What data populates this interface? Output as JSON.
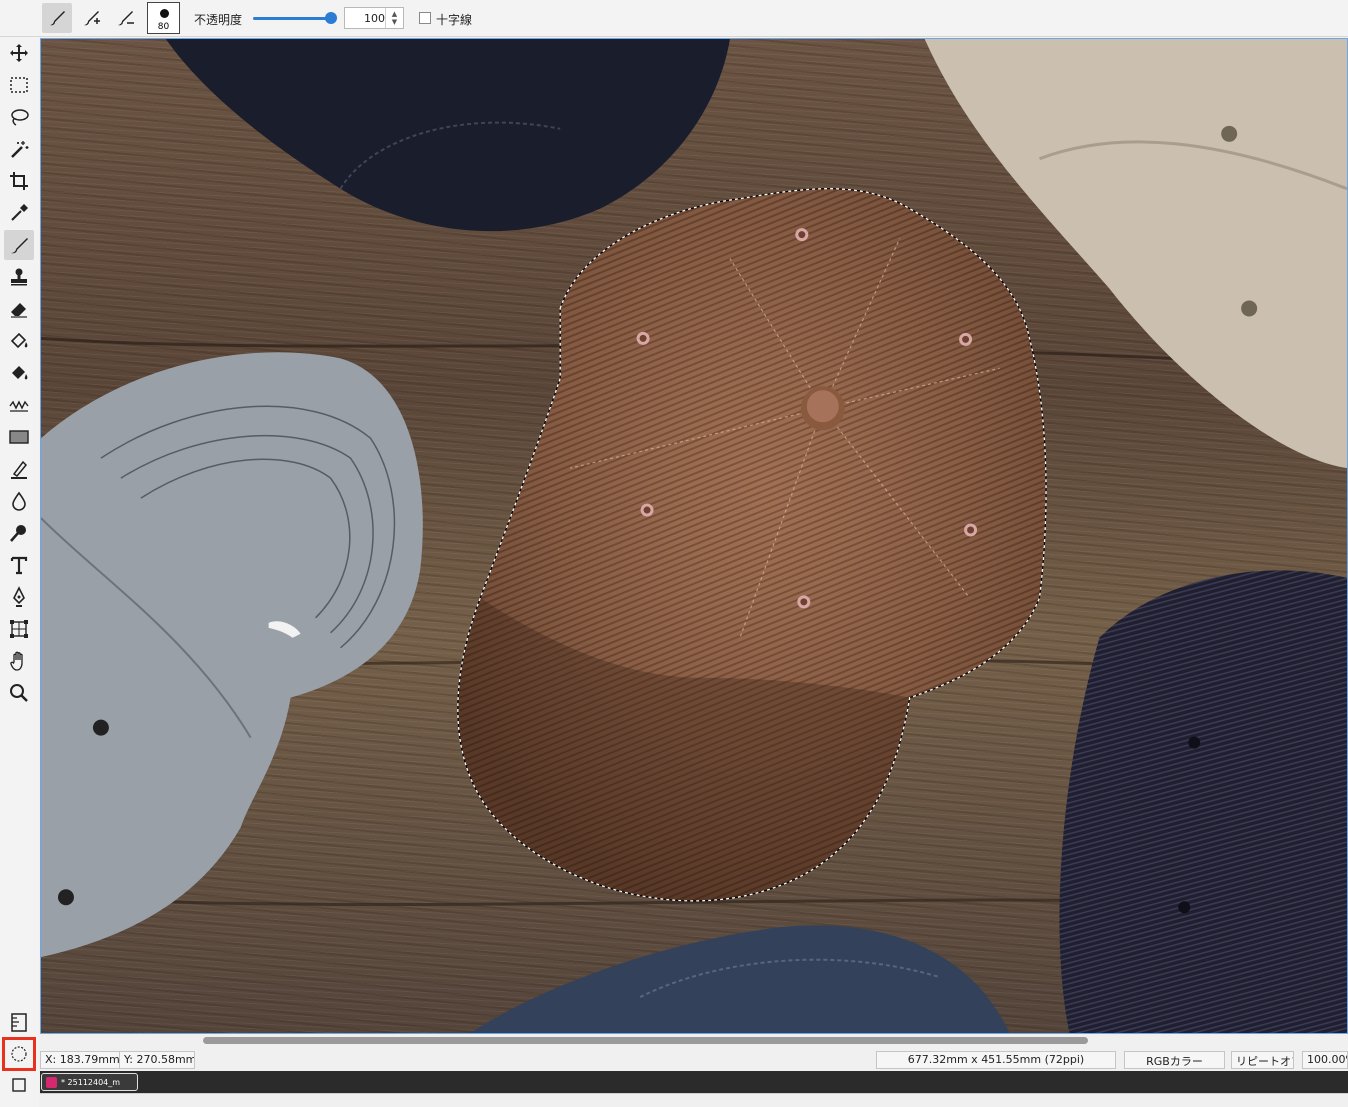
{
  "options_bar": {
    "brush_modes": [
      {
        "icon": "brush-normal-icon"
      },
      {
        "icon": "brush-plus-icon"
      },
      {
        "icon": "brush-minus-icon"
      }
    ],
    "brush_size": "80",
    "opacity_label": "不透明度",
    "opacity_value": "100",
    "opacity_fraction": 1.0,
    "crosshair_label": "十字線",
    "crosshair_checked": false
  },
  "toolbar": {
    "tools": [
      {
        "name": "move",
        "icon": "move-icon"
      },
      {
        "name": "rect-select",
        "icon": "rect-select-icon"
      },
      {
        "name": "lasso",
        "icon": "lasso-icon"
      },
      {
        "name": "magic-wand",
        "icon": "magic-wand-icon"
      },
      {
        "name": "crop",
        "icon": "crop-icon"
      },
      {
        "name": "eyedropper",
        "icon": "eyedropper-icon"
      },
      {
        "name": "brush",
        "icon": "brush-icon",
        "active": true
      },
      {
        "name": "stamp",
        "icon": "stamp-icon"
      },
      {
        "name": "eraser",
        "icon": "eraser-icon"
      },
      {
        "name": "fill",
        "icon": "paint-bucket-icon"
      },
      {
        "name": "fill-alt",
        "icon": "paint-bucket-alt-icon"
      },
      {
        "name": "wave",
        "icon": "wave-icon"
      },
      {
        "name": "rectangle",
        "icon": "rectangle-icon"
      },
      {
        "name": "pen-edit",
        "icon": "pen-edit-icon"
      },
      {
        "name": "blur",
        "icon": "drop-icon"
      },
      {
        "name": "dodge",
        "icon": "dodge-icon"
      },
      {
        "name": "text",
        "icon": "text-icon"
      },
      {
        "name": "pen",
        "icon": "pen-icon"
      },
      {
        "name": "transform",
        "icon": "transform-icon"
      },
      {
        "name": "hand",
        "icon": "hand-icon"
      },
      {
        "name": "zoom",
        "icon": "zoom-icon"
      }
    ],
    "bottom_tools": [
      {
        "name": "ruler",
        "icon": "ruler-icon"
      },
      {
        "name": "selection-mode",
        "icon": "dashed-circle-icon"
      },
      {
        "name": "quick-mask",
        "icon": "square-icon"
      }
    ]
  },
  "status_bar": {
    "x_coord": "X:  183.79mm",
    "y_coord": "Y:  270.58mm",
    "doc_size": "677.32mm x 451.55mm (72ppi)",
    "color_mode": "RGBカラー",
    "repeat": "リピートオフ",
    "zoom": "100.00%"
  },
  "document_tab": {
    "label": "* 25112404_m"
  }
}
